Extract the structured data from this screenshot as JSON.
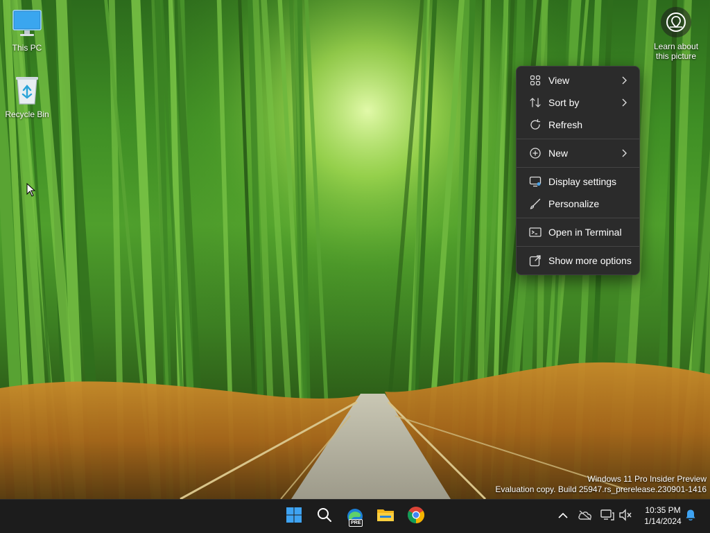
{
  "desktop": {
    "icons": [
      {
        "label": "This PC",
        "icon": "monitor-icon"
      },
      {
        "label": "Recycle Bin",
        "icon": "recycle-bin-icon"
      }
    ],
    "learn_about": {
      "line1": "Learn about",
      "line2": "this picture",
      "icon": "location-info-icon"
    }
  },
  "context_menu": {
    "items": [
      {
        "label": "View",
        "icon": "grid-icon",
        "submenu": true
      },
      {
        "label": "Sort by",
        "icon": "sort-icon",
        "submenu": true
      },
      {
        "label": "Refresh",
        "icon": "refresh-icon",
        "submenu": false
      },
      {
        "label": "New",
        "icon": "plus-circle-icon",
        "submenu": true
      },
      {
        "label": "Display settings",
        "icon": "display-icon",
        "submenu": false
      },
      {
        "label": "Personalize",
        "icon": "brush-icon",
        "submenu": false
      },
      {
        "label": "Open in Terminal",
        "icon": "terminal-icon",
        "submenu": false
      },
      {
        "label": "Show more options",
        "icon": "share-icon",
        "submenu": false
      }
    ]
  },
  "watermark": {
    "line1": "Windows 11 Pro Insider Preview",
    "line2": "Evaluation copy. Build 25947.rs_prerelease.230901-1416"
  },
  "taskbar": {
    "apps": [
      {
        "name": "Start",
        "icon": "windows-logo-icon"
      },
      {
        "name": "Search",
        "icon": "search-icon"
      },
      {
        "name": "Edge Preview",
        "icon": "edge-icon",
        "badge": "PRE"
      },
      {
        "name": "File Explorer",
        "icon": "folder-icon"
      },
      {
        "name": "Chrome",
        "icon": "chrome-icon"
      }
    ],
    "tray": {
      "time": "10:35 PM",
      "date": "1/14/2024"
    }
  },
  "colors": {
    "menu_bg": "#2b2b2b",
    "taskbar_bg": "#1c1c1c",
    "accent": "#0078d4"
  }
}
